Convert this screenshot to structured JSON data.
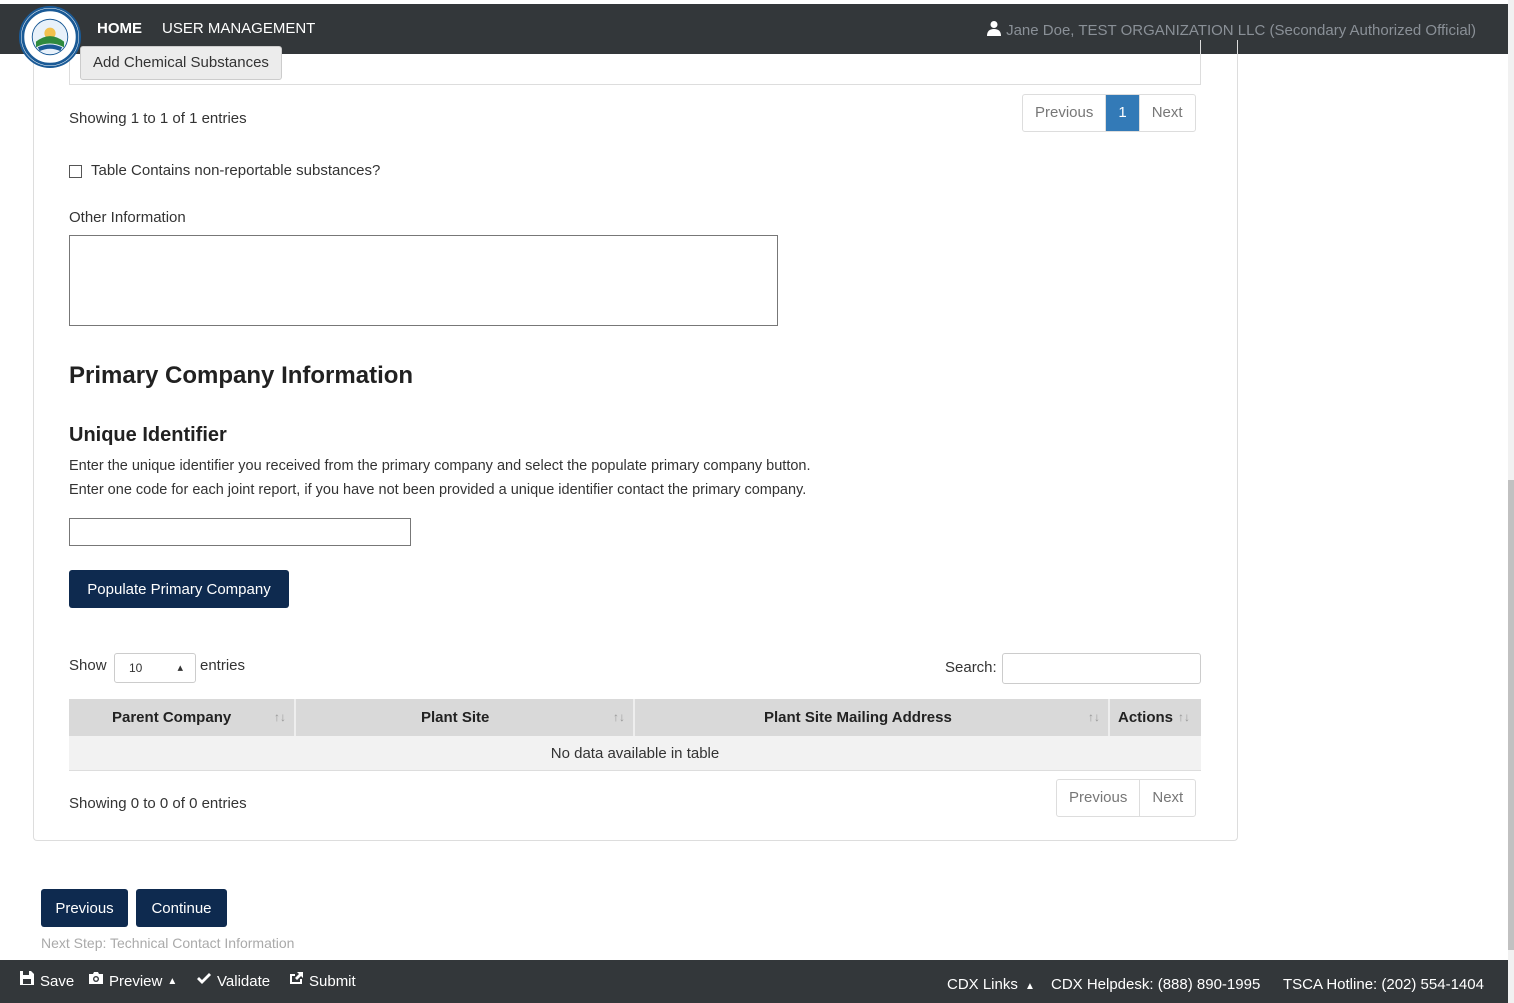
{
  "header": {
    "nav_home": "HOME",
    "nav_user_management": "USER MANAGEMENT",
    "user": "Jane Doe, TEST ORGANIZATION LLC (Secondary Authorized Official)"
  },
  "substances": {
    "add_button": "Add Chemical Substances",
    "showing": "Showing 1 to 1 of 1 entries",
    "pager": {
      "previous": "Previous",
      "page": "1",
      "next": "Next"
    },
    "nonreportable_label": "Table Contains non-reportable substances?",
    "nonreportable_checked": false,
    "other_info_label": "Other Information",
    "other_info_value": ""
  },
  "primary_company": {
    "heading": "Primary Company Information",
    "uid_heading": "Unique Identifier",
    "instruction_1": "Enter the unique identifier you received from the primary company and select the populate primary company button.",
    "instruction_2": "Enter one code for each joint report, if you have not been provided a unique identifier contact the primary company.",
    "uid_value": "",
    "populate_button": "Populate Primary Company",
    "show_label": "Show",
    "entries_value": "10",
    "entries_label": "entries",
    "search_label": "Search:",
    "search_value": "",
    "columns": [
      "Parent Company",
      "Plant Site",
      "Plant Site Mailing Address",
      "Actions"
    ],
    "empty_message": "No data available in table",
    "showing": "Showing 0 to 0 of 0 entries",
    "pager": {
      "previous": "Previous",
      "next": "Next"
    }
  },
  "wizard": {
    "previous_button": "Previous",
    "continue_button": "Continue",
    "next_step": "Next Step: Technical Contact Information"
  },
  "footer": {
    "save": "Save",
    "preview": "Preview",
    "validate": "Validate",
    "submit": "Submit",
    "cdx_links": "CDX Links",
    "helpdesk": "CDX Helpdesk: (888) 890-1995",
    "hotline": "TSCA Hotline: (202) 554-1404"
  },
  "colors": {
    "navbar": "#33373a",
    "primary_button": "#0e2a4f",
    "active_page": "#337ab7"
  }
}
